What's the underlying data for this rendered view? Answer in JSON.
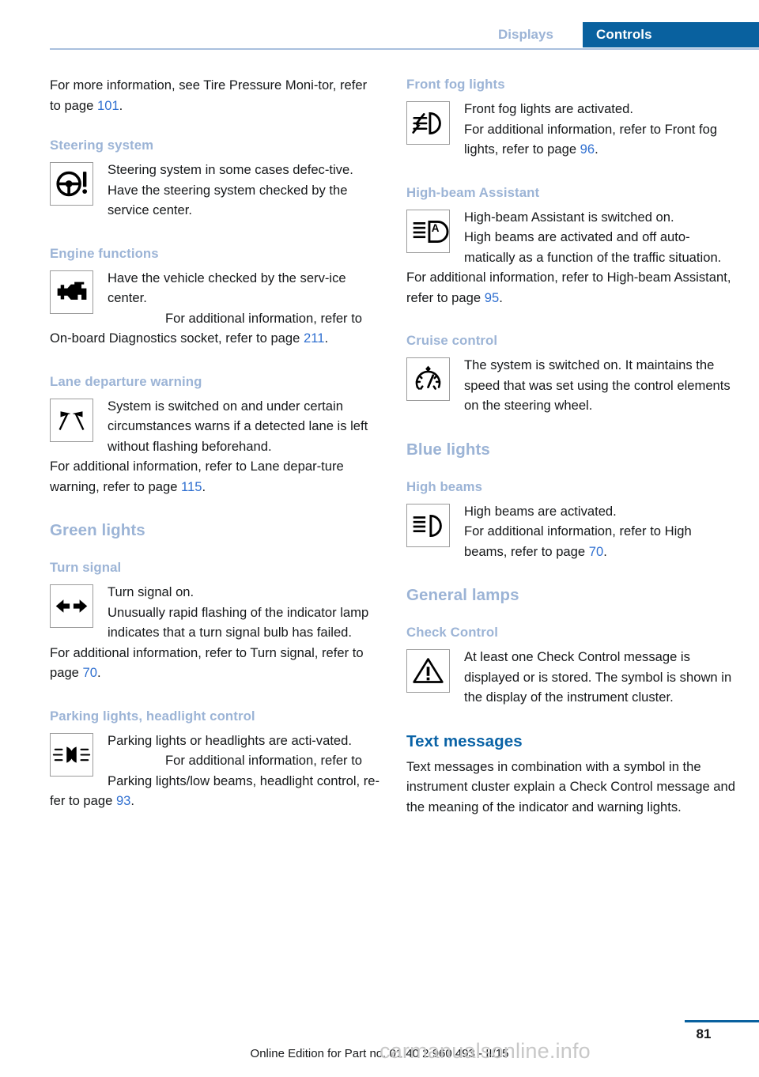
{
  "header": {
    "tab_inactive": "Displays",
    "tab_active": "Controls",
    "accent_blue": "#09619f",
    "muted_blue": "#9cb4d6"
  },
  "left_column": {
    "intro": {
      "text_before": "For more information, see Tire Pressure Moni-tor, refer to page ",
      "page": "101",
      "text_after": "."
    },
    "steering": {
      "heading": "Steering system",
      "icon": "steering-wheel-warning-icon",
      "line1": "Steering system in some cases defec-tive.",
      "line2": "Have the steering system checked by the service center."
    },
    "engine": {
      "heading": "Engine functions",
      "icon": "check-engine-icon",
      "line1": "Have the vehicle checked by the serv-ice center.",
      "line2_before": "For additional information, refer to On-board Diagnostics socket, refer to page ",
      "line2_page": "211",
      "line2_after": "."
    },
    "lane": {
      "heading": "Lane departure warning",
      "icon": "lane-departure-icon",
      "line1": "System is switched on and under certain circumstances warns if a detected lane is left without flashing beforehand.",
      "line2_before": "For additional information, refer to Lane depar-ture warning, refer to page ",
      "line2_page": "115",
      "line2_after": "."
    },
    "green_lights": {
      "heading": "Green lights"
    },
    "turn_signal": {
      "heading": "Turn signal",
      "icon": "turn-signal-arrows-icon",
      "line1": "Turn signal on.",
      "line2": "Unusually rapid flashing of the indicator lamp indicates that a turn signal bulb has failed.",
      "line3_before": "For additional information, refer to Turn signal, refer to page ",
      "line3_page": "70",
      "line3_after": "."
    },
    "parking": {
      "heading": "Parking lights, headlight control",
      "icon": "parking-lights-icon",
      "line1": "Parking lights or headlights are acti-vated.",
      "line2_before": "For additional information, refer to Parking lights/low beams, headlight control, re-fer to page ",
      "line2_page": "93",
      "line2_after": "."
    }
  },
  "right_column": {
    "fog": {
      "heading": "Front fog lights",
      "icon": "front-fog-light-icon",
      "line1": "Front fog lights are activated.",
      "line2_before": "For additional information, refer to Front fog lights, refer to page ",
      "line2_page": "96",
      "line2_after": "."
    },
    "highbeam_assistant": {
      "heading": "High-beam Assistant",
      "icon": "high-beam-assistant-icon",
      "line1": "High-beam Assistant is switched on.",
      "line2": "High beams are activated and off auto-matically as a function of the traffic situation.",
      "line3_before": "For additional information, refer to High-beam Assistant, refer to page ",
      "line3_page": "95",
      "line3_after": "."
    },
    "cruise": {
      "heading": "Cruise control",
      "icon": "cruise-control-gauge-icon",
      "line1": "The system is switched on. It maintains the speed that was set using the control elements on the steering wheel."
    },
    "blue_lights": {
      "heading": "Blue lights"
    },
    "high_beams": {
      "heading": "High beams",
      "icon": "high-beam-icon",
      "line1": "High beams are activated.",
      "line2_before": "For additional information, refer to High beams, refer to page ",
      "line2_page": "70",
      "line2_after": "."
    },
    "general_lamps": {
      "heading": "General lamps"
    },
    "check_control": {
      "heading": "Check Control",
      "icon": "warning-triangle-icon",
      "line1": "At least one Check Control message is displayed or is stored. The symbol is shown in the display of the instrument cluster."
    },
    "text_messages": {
      "heading": "Text messages",
      "body": "Text messages in combination with a symbol in the instrument cluster explain a Check Control message and the meaning of the indicator and warning lights."
    }
  },
  "footer": {
    "edition": "Online Edition for Part no. 01 40 2 960 493 - II/15",
    "page_number": "81",
    "watermark": "carmanualsonline.info"
  }
}
